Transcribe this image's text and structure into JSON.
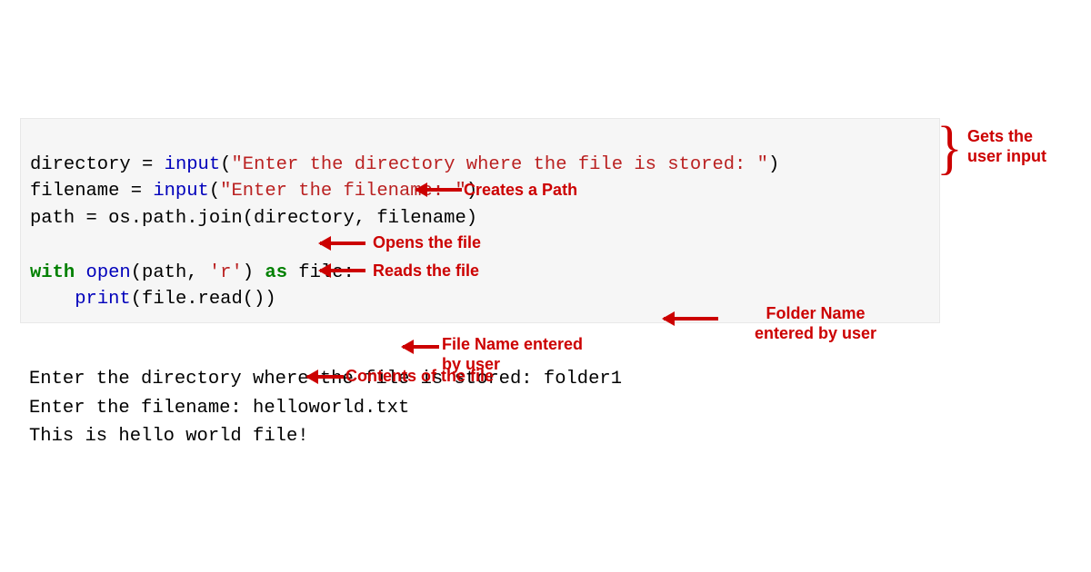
{
  "code": {
    "line1": {
      "var": "directory ",
      "eq": "= ",
      "fn": "input",
      "paren_open": "(",
      "str": "\"Enter the directory where the file is stored: \"",
      "paren_close": ")"
    },
    "line2": {
      "var": "filename ",
      "eq": "= ",
      "fn": "input",
      "paren_open": "(",
      "str": "\"Enter the filename: \"",
      "paren_close": ")"
    },
    "line3": {
      "text": "path = os.path.join(directory, filename)"
    },
    "line5": {
      "with": "with",
      "sp1": " ",
      "open": "open",
      "args_open": "(path, ",
      "mode": "'r'",
      "args_close": ") ",
      "as": "as",
      "sp2": " file:"
    },
    "line6": {
      "indent": "    ",
      "print": "print",
      "args": "(file.read())"
    }
  },
  "output": {
    "line1": "Enter the directory where the file is stored: folder1",
    "line2": "Enter the filename: helloworld.txt",
    "line3": "This is hello world file!"
  },
  "annotations": {
    "user_input": "Gets the\nuser input",
    "creates_path": "Creates a Path",
    "opens_file": "Opens the file",
    "reads_file": "Reads the file",
    "folder_name": "Folder Name\nentered by user",
    "file_name": "File Name entered\nby user",
    "contents": "Contents of the file"
  }
}
